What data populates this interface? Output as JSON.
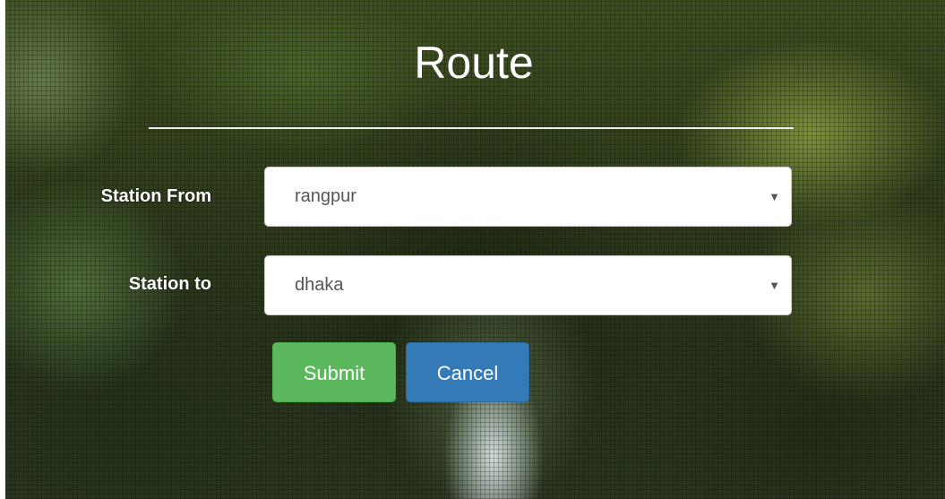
{
  "form": {
    "title": "Route",
    "station_from": {
      "label": "Station From",
      "selected": "rangpur"
    },
    "station_to": {
      "label": "Station to",
      "selected": "dhaka"
    },
    "submit_label": "Submit",
    "cancel_label": "Cancel"
  },
  "icons": {
    "dropdown_caret": "chevron-down-icon"
  },
  "colors": {
    "submit_button": "#5cb85c",
    "cancel_button": "#337ab7",
    "title_text": "#ffffff",
    "input_text": "#555555"
  }
}
